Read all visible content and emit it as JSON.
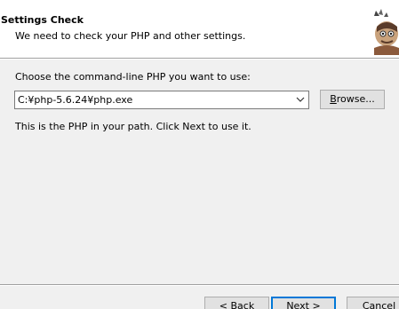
{
  "header": {
    "title": "Settings Check",
    "subtitle": "We need to check your PHP and other settings."
  },
  "php_select": {
    "prompt": "Choose the command-line PHP you want to use:",
    "selected_value": "C:¥php-5.6.24¥php.exe",
    "browse_label_prefix": "B",
    "browse_label_rest": "rowse...",
    "info": "This is the PHP in your path. Click Next to use it."
  },
  "footer": {
    "back_label": "< Back",
    "next_label": "Next >",
    "cancel_label": "Cancel"
  },
  "colors": {
    "accent": "#0078d7"
  }
}
